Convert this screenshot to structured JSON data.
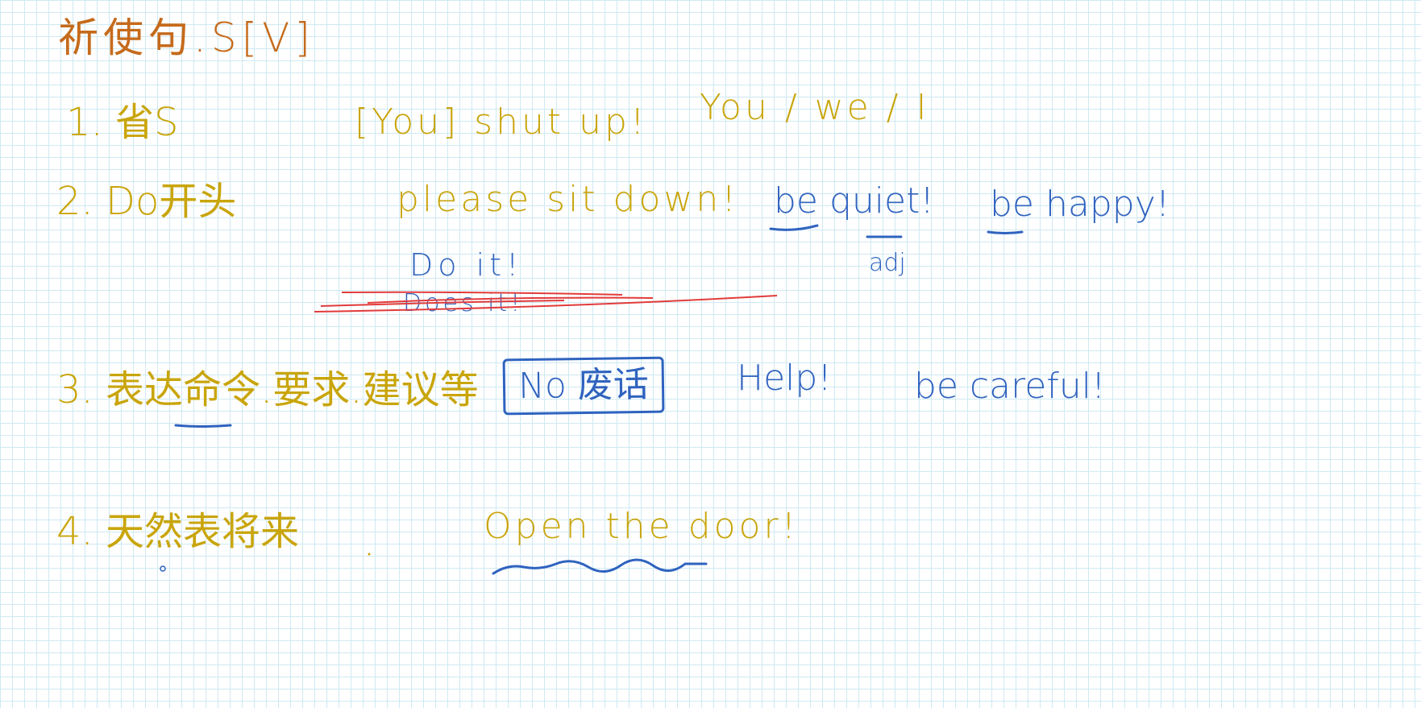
{
  "title": "祈使句.S[V]",
  "rows": [
    {
      "label": "1. 省S",
      "example": "[You] shut up!",
      "note": "You / we / I"
    },
    {
      "label": "2. Do开头",
      "example": "please sit down!",
      "note_a": "be quiet!",
      "note_b": "be happy!",
      "annotation": "adj",
      "correct": "Do it!",
      "wrong": "Does it!"
    },
    {
      "label": "3. 表达命令.要求.建议等",
      "boxed": "No 废话",
      "example_a": "Help!",
      "example_b": "be careful!"
    },
    {
      "label": "4. 天然表将来",
      "example": "Open the door!"
    }
  ],
  "colors": {
    "orange_ink": "#c56a1b",
    "yellow_ink": "#c9a50c",
    "blue_ink": "#2f63bf",
    "red_ink": "#e23b3b",
    "grid": "#cfe9f3"
  }
}
